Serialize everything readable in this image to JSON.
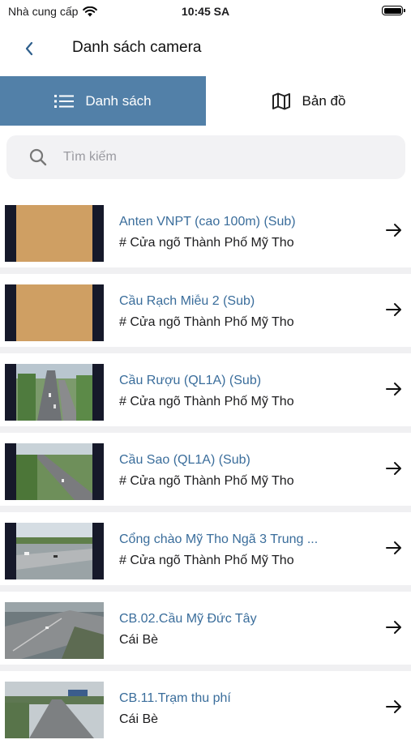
{
  "status_bar": {
    "carrier": "Nhà cung cấp",
    "time": "10:45 SA"
  },
  "navbar": {
    "title": "Danh sách camera"
  },
  "tabs": [
    {
      "label": "Danh sách",
      "icon": "list-icon",
      "active": true
    },
    {
      "label": "Bản đồ",
      "icon": "map-icon",
      "active": false
    }
  ],
  "search": {
    "placeholder": "Tìm kiếm",
    "value": ""
  },
  "cameras": [
    {
      "name": "Anten VNPT (cao 100m) (Sub)",
      "area": "# Cửa ngõ Thành Phố Mỹ Tho",
      "thumb": "placeholder"
    },
    {
      "name": "Cầu Rạch Miễu 2 (Sub)",
      "area": "# Cửa ngõ Thành Phố Mỹ Tho",
      "thumb": "placeholder"
    },
    {
      "name": "Cầu Rượu (QL1A) (Sub)",
      "area": "# Cửa ngõ Thành Phố Mỹ Tho",
      "thumb": "road-vertical"
    },
    {
      "name": "Cầu Sao (QL1A) (Sub)",
      "area": "# Cửa ngõ Thành Phố Mỹ Tho",
      "thumb": "road-diagonal"
    },
    {
      "name": "Cổng chào Mỹ Tho Ngã 3 Trung ...",
      "area": "# Cửa ngõ Thành Phố Mỹ Tho",
      "thumb": "intersection"
    },
    {
      "name": "CB.02.Cầu Mỹ Đức Tây",
      "area": "Cái Bè",
      "thumb": "highway"
    },
    {
      "name": "CB.11.Trạm thu phí",
      "area": "Cái Bè",
      "thumb": "tollway"
    }
  ],
  "colors": {
    "tab_active": "#5280a8",
    "camera_name": "#3a6d9b",
    "separator": "#f0f0f2"
  }
}
